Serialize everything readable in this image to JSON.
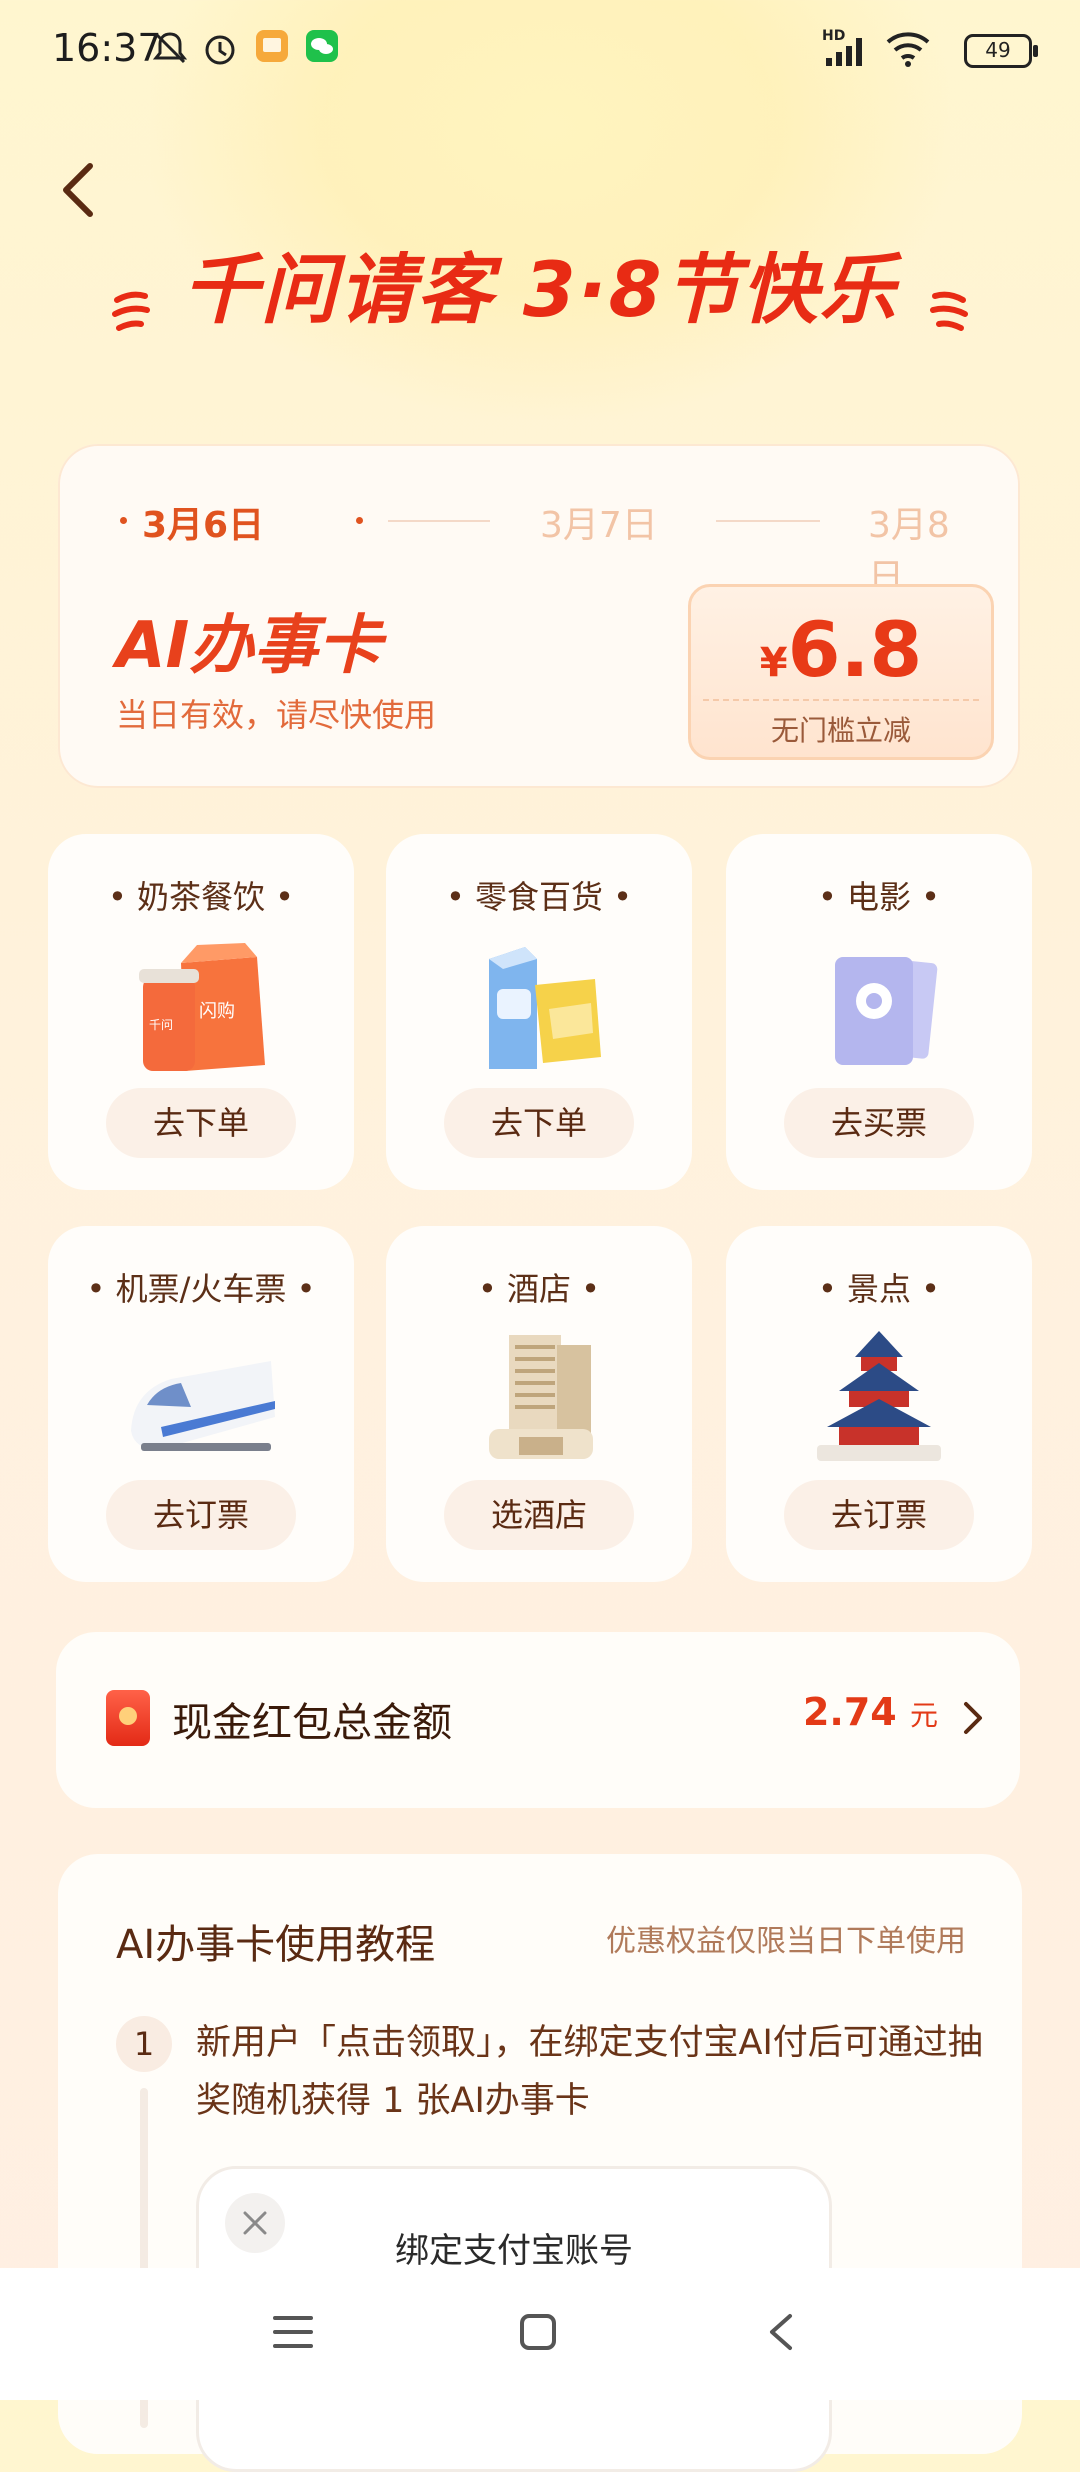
{
  "status_bar": {
    "time": "16:37",
    "signal_label": "HD",
    "battery": "49"
  },
  "header": {
    "title": "千问请客 3·8节快乐"
  },
  "ai_card": {
    "dates": [
      "3月6日",
      "3月7日",
      "3月8日"
    ],
    "active_date_index": 0,
    "name": "AI办事卡",
    "subtitle": "当日有效，请尽快使用",
    "coupon": {
      "currency": "¥",
      "amount": "6.8",
      "caption": "无门槛立减"
    }
  },
  "services": [
    {
      "label": "奶茶餐饮",
      "button": "去下单",
      "icon": "milk-tea-icon"
    },
    {
      "label": "零食百货",
      "button": "去下单",
      "icon": "snacks-icon"
    },
    {
      "label": "电影",
      "button": "去买票",
      "icon": "movie-ticket-icon"
    },
    {
      "label": "机票/火车票",
      "button": "去订票",
      "icon": "train-icon"
    },
    {
      "label": "酒店",
      "button": "选酒店",
      "icon": "hotel-icon"
    },
    {
      "label": "景点",
      "button": "去订票",
      "icon": "temple-icon"
    }
  ],
  "cup_brand": "千问",
  "bag_brand": "闪购",
  "red_packet": {
    "label": "现金红包总金额",
    "amount": "2.74",
    "unit": "元"
  },
  "tutorial": {
    "title": "AI办事卡使用教程",
    "note": "优惠权益仅限当日下单使用",
    "step_number": "1",
    "step_text": "新用户「点击领取」，在绑定支付宝AI付后可通过抽奖随机获得 1 张AI办事卡",
    "modal_title": "绑定支付宝账号"
  },
  "colors": {
    "accent_red": "#e82b14",
    "orange": "#e0531f",
    "brown_text": "#5a2a12"
  }
}
